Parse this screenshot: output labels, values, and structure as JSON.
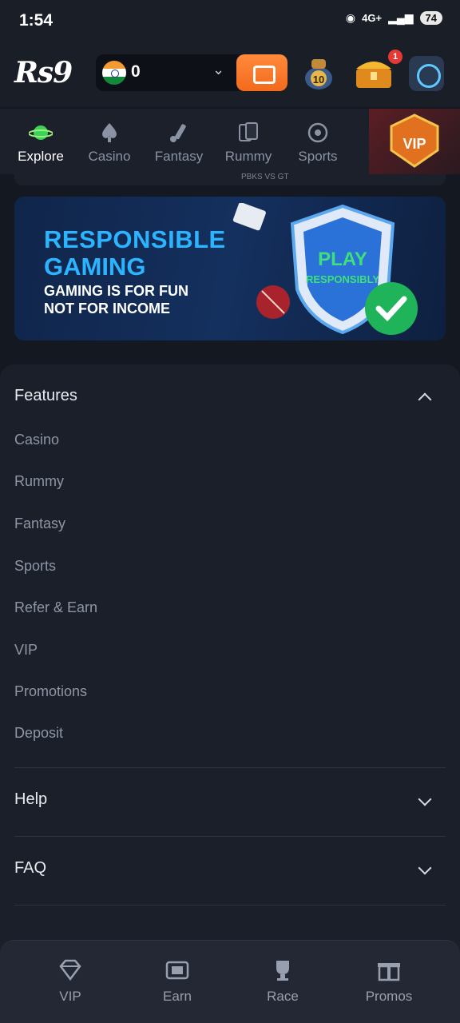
{
  "status": {
    "time": "1:54",
    "network": "4G+",
    "battery": "74"
  },
  "header": {
    "logo": "Rs9",
    "balance": "0",
    "notification_count": "1"
  },
  "nav": {
    "items": [
      {
        "label": "Explore",
        "icon": "planet-icon",
        "active": true
      },
      {
        "label": "Casino",
        "icon": "spade-icon",
        "active": false
      },
      {
        "label": "Fantasy",
        "icon": "cricket-bat-icon",
        "active": false
      },
      {
        "label": "Rummy",
        "icon": "cards-icon",
        "active": false
      },
      {
        "label": "Sports",
        "icon": "football-icon",
        "active": false
      }
    ],
    "vip_label": "VIP"
  },
  "strip": {
    "match": "PBKS VS GT"
  },
  "banner": {
    "title_line1": "RESPONSIBLE",
    "title_line2": "GAMING",
    "sub_line1": "GAMING IS FOR FUN",
    "sub_line2": "NOT FOR INCOME",
    "shield_line1": "PLAY",
    "shield_line2": "RESPONSIBLY",
    "pot_level": "10"
  },
  "features": {
    "heading": "Features",
    "links": [
      "Casino",
      "Rummy",
      "Fantasy",
      "Sports",
      "Refer & Earn",
      "VIP",
      "Promotions",
      "Deposit"
    ]
  },
  "help": {
    "heading": "Help"
  },
  "faq": {
    "heading": "FAQ"
  },
  "bottom_nav": {
    "items": [
      {
        "label": "VIP",
        "icon": "diamond-icon"
      },
      {
        "label": "Earn",
        "icon": "earn-icon"
      },
      {
        "label": "Race",
        "icon": "trophy-icon"
      },
      {
        "label": "Promos",
        "icon": "gift-icon"
      }
    ]
  },
  "colors": {
    "accent": "#f36a1c",
    "banner_title": "#2bb4ff",
    "background": "#141820",
    "panel": "#1b1f29"
  }
}
